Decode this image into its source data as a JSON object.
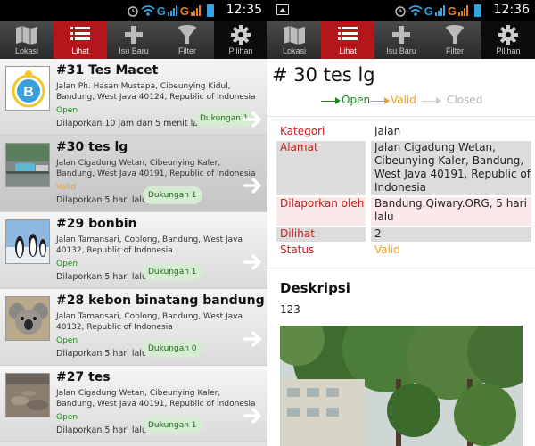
{
  "left": {
    "status_time": "12:35",
    "tabs": [
      {
        "label": "Lokasi"
      },
      {
        "label": "Lihat"
      },
      {
        "label": "Isu Baru"
      },
      {
        "label": "Filter"
      },
      {
        "label": "Pilihan"
      }
    ],
    "reports": [
      {
        "title": "#31 Tes Macet",
        "address": "Jalan Ph. Hasan Mustapa, Cibeunying Kidul, Bandung, West Java 40124, Republic of Indonesia",
        "status": "Open",
        "reported": "Dilaporkan 10 jam dan 5 menit lalu",
        "support": "Dukungan 1",
        "thumb": "logo"
      },
      {
        "title": "#30 tes lg",
        "address": "Jalan Cigadung Wetan, Cibeunying Kaler, Bandung, West Java 40191, Republic of Indonesia",
        "status": "Valid",
        "reported": "Dilaporkan 5 hari lalu",
        "support": "Dukungan 1",
        "thumb": "street"
      },
      {
        "title": "#29 bonbin",
        "address": "Jalan Tamansari, Coblong, Bandung, West Java 40132, Republic of Indonesia",
        "status": "Open",
        "reported": "Dilaporkan 5 hari lalu",
        "support": "Dukungan 1",
        "thumb": "penguins"
      },
      {
        "title": "#28 kebon binatang bandung",
        "address": "Jalan Tamansari, Coblong, Bandung, West Java 40132, Republic of Indonesia",
        "status": "Open",
        "reported": "Dilaporkan 5 hari lalu",
        "support": "Dukungan 0",
        "thumb": "koala"
      },
      {
        "title": "#27 tes",
        "address": "Jalan Cigadung Wetan, Cibeunying Kaler, Bandung, West Java 40191, Republic of Indonesia",
        "status": "Open",
        "reported": "Dilaporkan 5 hari lalu",
        "support": "Dukungan 1",
        "thumb": "rubble"
      }
    ]
  },
  "right": {
    "status_time": "12:36",
    "title": "# 30 tes lg",
    "flow": {
      "open": "Open",
      "valid": "Valid",
      "closed": "Closed"
    },
    "fields": {
      "kategori_label": "Kategori",
      "kategori_value": "Jalan",
      "alamat_label": "Alamat",
      "alamat_value": "Jalan Cigadung Wetan, Cibeunying Kaler, Bandung, West Java 40191, Republic of Indonesia",
      "dilaporkan_label": "Dilaporkan oleh",
      "dilaporkan_value": "Bandung.Qiwary.ORG, 5 hari lalu",
      "dilihat_label": "Dilihat",
      "dilihat_value": "2",
      "status_label": "Status",
      "status_value": "Valid"
    },
    "description_heading": "Deskripsi",
    "description_body": "123"
  },
  "colors": {
    "accent_red": "#b3171b",
    "status_open": "#1d8a1d",
    "status_valid": "#f0a020",
    "label_red": "#c81b1b",
    "support_bg": "#d5ecd3"
  },
  "icons": [
    "map-icon",
    "list-icon",
    "plus-icon",
    "funnel-icon",
    "gear-icon",
    "wifi-icon",
    "alarm-icon",
    "image-icon",
    "arrow-right-icon"
  ]
}
